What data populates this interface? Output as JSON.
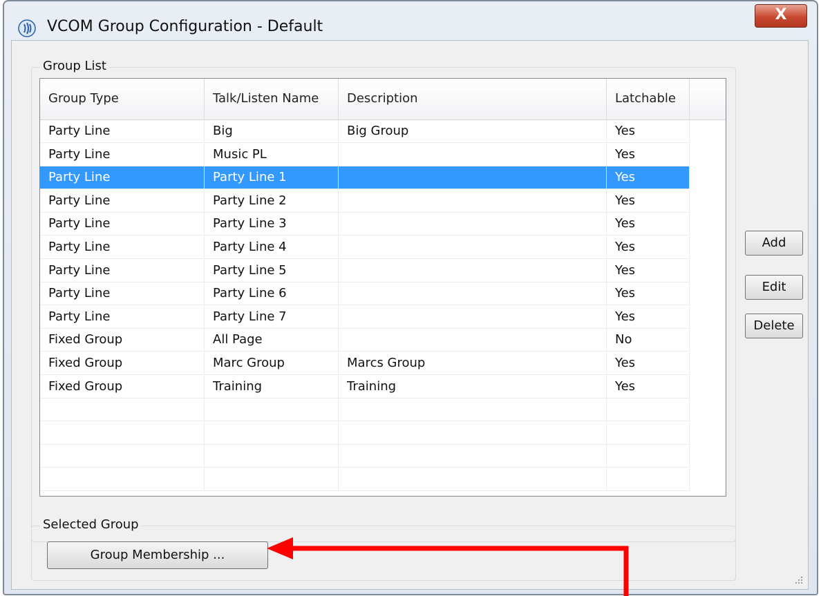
{
  "window": {
    "title": "VCOM Group Configuration - Default",
    "close_label": "X"
  },
  "group_list": {
    "legend": "Group List",
    "columns": [
      "Group Type",
      "Talk/Listen Name",
      "Description",
      "Latchable"
    ],
    "rows": [
      {
        "type": "Party Line",
        "name": "Big",
        "description": "Big Group",
        "latchable": "Yes"
      },
      {
        "type": "Party Line",
        "name": "Music PL",
        "description": "",
        "latchable": "Yes"
      },
      {
        "type": "Party Line",
        "name": "Party Line 1",
        "description": "",
        "latchable": "Yes"
      },
      {
        "type": "Party Line",
        "name": "Party Line 2",
        "description": "",
        "latchable": "Yes"
      },
      {
        "type": "Party Line",
        "name": "Party Line 3",
        "description": "",
        "latchable": "Yes"
      },
      {
        "type": "Party Line",
        "name": "Party Line 4",
        "description": "",
        "latchable": "Yes"
      },
      {
        "type": "Party Line",
        "name": "Party Line 5",
        "description": "",
        "latchable": "Yes"
      },
      {
        "type": "Party Line",
        "name": "Party Line 6",
        "description": "",
        "latchable": "Yes"
      },
      {
        "type": "Party Line",
        "name": "Party Line 7",
        "description": "",
        "latchable": "Yes"
      },
      {
        "type": "Fixed Group",
        "name": "All Page",
        "description": "",
        "latchable": "No"
      },
      {
        "type": "Fixed Group",
        "name": "Marc Group",
        "description": "Marcs Group",
        "latchable": "Yes"
      },
      {
        "type": "Fixed Group",
        "name": "Training",
        "description": "Training",
        "latchable": "Yes"
      }
    ],
    "selected_row_index": 2
  },
  "buttons": {
    "add": "Add",
    "edit": "Edit",
    "delete": "Delete"
  },
  "selected_group": {
    "legend": "Selected Group",
    "membership_button": "Group Membership ..."
  },
  "colors": {
    "selection": "#3399ff",
    "annotation_arrow": "#ff0000",
    "close_button": "#c94a33"
  },
  "icons": {
    "title": "vcom-app-icon",
    "close": "close-icon"
  }
}
